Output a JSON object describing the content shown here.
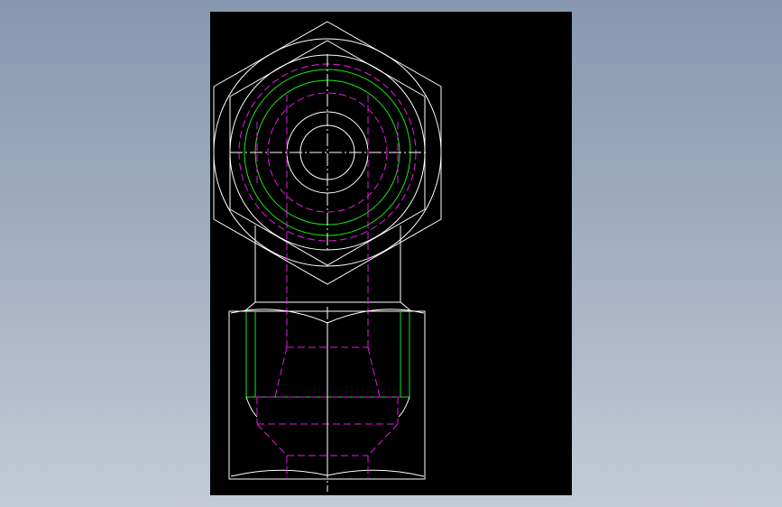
{
  "colors": {
    "background_top": "#8797ae",
    "background_bottom": "#c4cbd7",
    "viewport": "#000000",
    "visible_edges": "#ffffff",
    "thread_lines": "#19e619",
    "hidden_lines": "#e619e6"
  }
}
